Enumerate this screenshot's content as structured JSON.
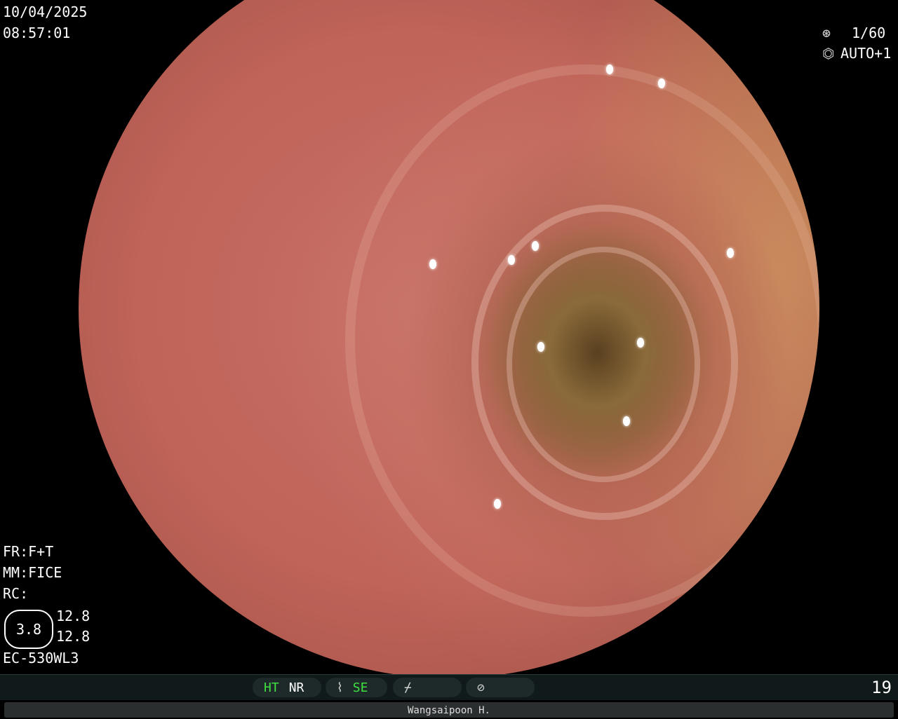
{
  "overlay": {
    "date": "10/04/2025",
    "time": "08:57:01",
    "shutter": "1/60",
    "iris": "AUTO+1",
    "fr": "FR:F+T",
    "mm": "MM:FICE",
    "rc": "RC:",
    "zoom": "3.8",
    "value_top": "12.8",
    "value_bottom": "12.8",
    "scope_model": "EC-530WL3"
  },
  "statusbar": {
    "ht": "HT",
    "nr": "NR",
    "se": "SE",
    "frame_count": "19"
  },
  "footer": {
    "operator": "Wangsaipoon H."
  },
  "icons": {
    "shutter": "shutter-icon",
    "iris": "iris-icon",
    "enhance": "enhance-icon",
    "signal": "signal-icon",
    "record": "record-icon"
  }
}
